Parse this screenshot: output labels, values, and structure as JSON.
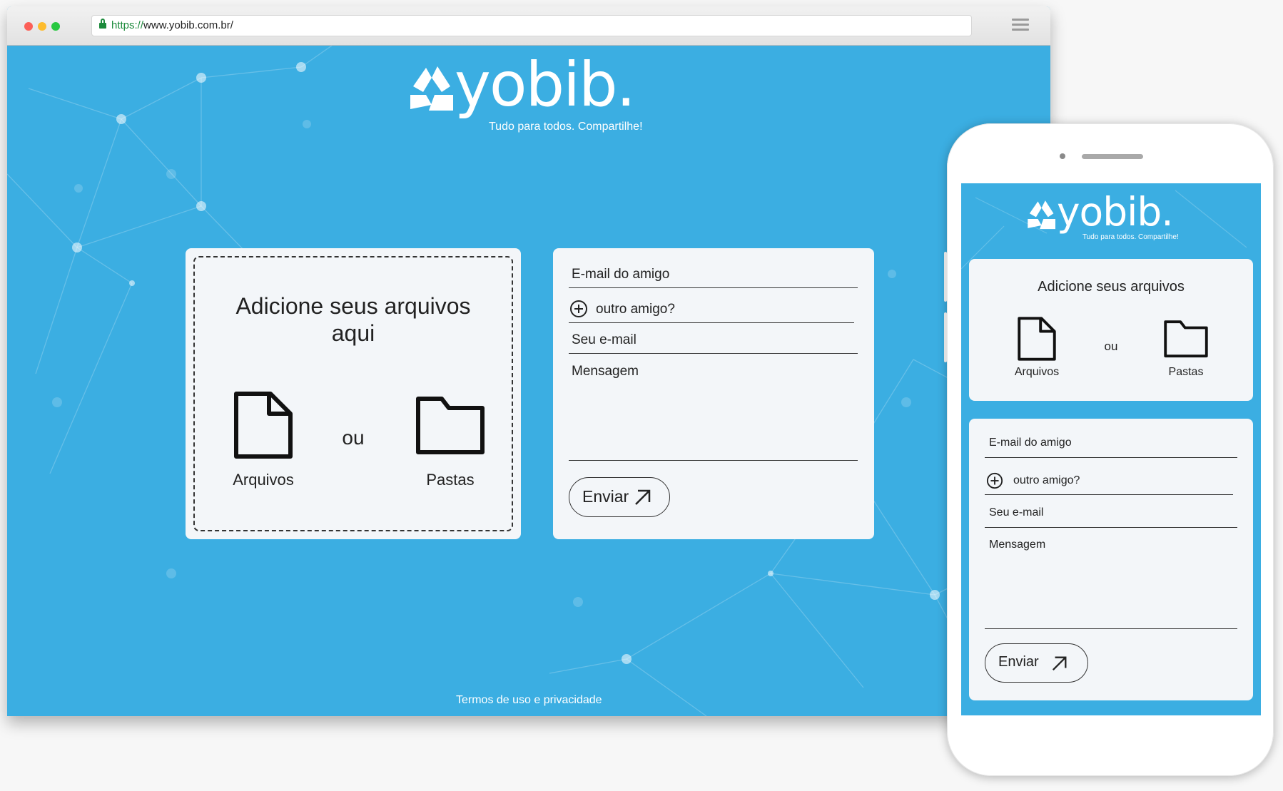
{
  "browser": {
    "url_scheme": "https://",
    "url_rest": "www.yobib.com.br/"
  },
  "brand": {
    "logo_text": "yobib.",
    "tagline": "Tudo para todos. Compartilhe!"
  },
  "upload": {
    "title": "Adicione seus arquivos aqui",
    "title_mobile": "Adicione seus arquivos",
    "files_label": "Arquivos",
    "or_label": "ou",
    "folders_label": "Pastas"
  },
  "form": {
    "friend_email_placeholder": "E-mail do amigo",
    "another_friend_label": "outro amigo?",
    "your_email_placeholder": "Seu e-mail",
    "message_placeholder": "Mensagem",
    "send_label": "Enviar"
  },
  "footer": {
    "terms_link": "Termos de uso e privacidade"
  },
  "colors": {
    "background": "#3baee2",
    "panel": "#f3f6f9",
    "text": "#222222",
    "secure_url": "#1c8a3b"
  },
  "icons": [
    "lock-icon",
    "menu-icon",
    "file-icon",
    "folder-icon",
    "plus-circle-icon",
    "arrow-up-right-icon",
    "logo-icon"
  ]
}
